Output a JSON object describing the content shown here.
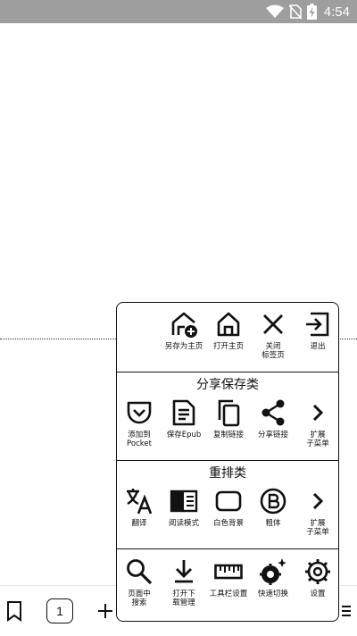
{
  "status_bar": {
    "time": "4:54"
  },
  "menu": {
    "top_row": [
      {
        "label": "另存为主页",
        "icon": "home-add-icon"
      },
      {
        "label": "打开主页",
        "icon": "home-icon"
      },
      {
        "label": "关闭\n标签页",
        "icon": "close-icon"
      },
      {
        "label": "退出",
        "icon": "exit-icon"
      }
    ],
    "share_section": {
      "title": "分享保存类",
      "items": [
        {
          "label": "添加到\nPocket",
          "icon": "pocket-icon"
        },
        {
          "label": "保存Epub",
          "icon": "document-icon"
        },
        {
          "label": "复制链接",
          "icon": "copy-icon"
        },
        {
          "label": "分享链接",
          "icon": "share-icon"
        },
        {
          "label": "扩展\n子菜单",
          "icon": "chevron-right-icon"
        }
      ]
    },
    "reflow_section": {
      "title": "重排类",
      "items": [
        {
          "label": "翻译",
          "icon": "translate-icon"
        },
        {
          "label": "阅读模式",
          "icon": "reader-mode-icon"
        },
        {
          "label": "白色背景",
          "icon": "white-background-icon"
        },
        {
          "label": "粗体",
          "icon": "bold-icon"
        },
        {
          "label": "扩展\n子菜单",
          "icon": "chevron-right-icon"
        }
      ]
    },
    "tools_row": [
      {
        "label": "页面中\n搜索",
        "icon": "search-icon"
      },
      {
        "label": "打开下\n载管理",
        "icon": "download-icon"
      },
      {
        "label": "工具栏设置",
        "icon": "ruler-icon"
      },
      {
        "label": "快速切换",
        "icon": "quick-switch-icon"
      },
      {
        "label": "设置",
        "icon": "gear-icon"
      }
    ]
  },
  "bottom_bar": {
    "tab_count": "1"
  }
}
